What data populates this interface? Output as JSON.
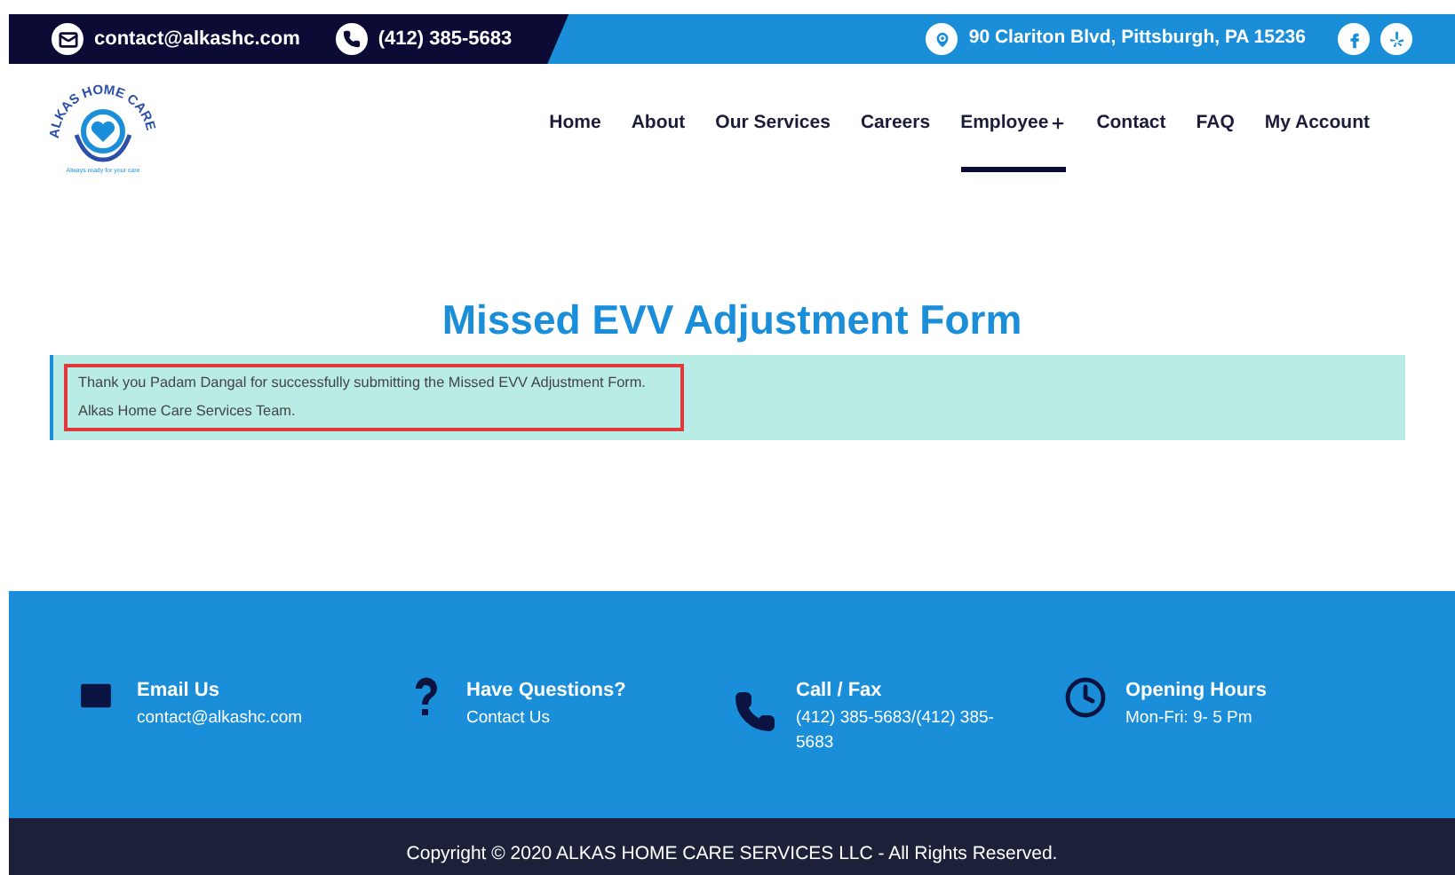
{
  "top_bar": {
    "email": "contact@alkashc.com",
    "phone": "(412) 385-5683",
    "address": "90 Clariton Blvd, Pittsburgh, PA 15236"
  },
  "logo": {
    "name": "ALKAS HOME CARE",
    "tagline": "Always ready for your care"
  },
  "nav": [
    {
      "label": "Home",
      "selected": false,
      "has_submenu": false
    },
    {
      "label": "About",
      "selected": false,
      "has_submenu": false
    },
    {
      "label": "Our Services",
      "selected": false,
      "has_submenu": false
    },
    {
      "label": "Careers",
      "selected": false,
      "has_submenu": false
    },
    {
      "label": "Employee",
      "selected": true,
      "has_submenu": true
    },
    {
      "label": "Contact",
      "selected": false,
      "has_submenu": false
    },
    {
      "label": "FAQ",
      "selected": false,
      "has_submenu": false
    },
    {
      "label": "My Account",
      "selected": false,
      "has_submenu": false
    }
  ],
  "title": "Missed EVV Adjustment Form",
  "message": [
    "Thank you Padam Dangal for successfully submitting the Missed EVV Adjustment Form.",
    "Alkas Home Care Services Team."
  ],
  "footer_items": [
    {
      "kind": "email",
      "title": "Email Us",
      "text": "contact@alkashc.com"
    },
    {
      "kind": "question",
      "title": "Have Questions?",
      "text": "Contact Us"
    },
    {
      "kind": "phone",
      "title": "Call / Fax",
      "text": "(412) 385-5683/(412) 385-5683"
    },
    {
      "kind": "clock",
      "title": "Opening Hours",
      "text": "Mon-Fri: 9- 5 Pm"
    }
  ],
  "copyright": "Copyright © 2020 ALKAS HOME CARE SERVICES LLC - All Rights Reserved."
}
